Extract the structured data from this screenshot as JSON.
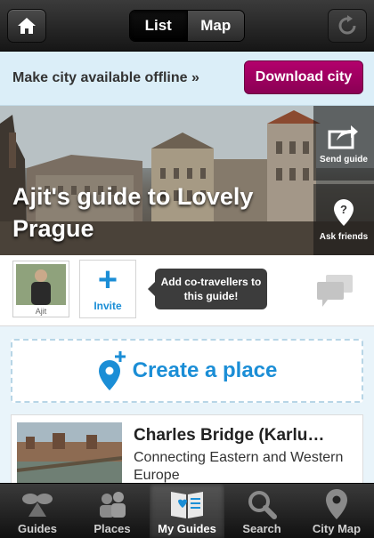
{
  "topbar": {
    "home_icon": "home-icon",
    "segments": [
      {
        "label": "List",
        "active": true
      },
      {
        "label": "Map",
        "active": false
      }
    ],
    "refresh_icon": "refresh-icon"
  },
  "offline": {
    "text": "Make city available offline »",
    "button_label": "Download city",
    "button_color": "#a00062"
  },
  "hero": {
    "title": "Ajit's guide to Lovely Prague",
    "send_label": "Send guide",
    "ask_label": "Ask friends"
  },
  "cotravellers": {
    "avatar_name": "Ajit",
    "invite_label": "Invite",
    "tooltip": "Add co-travellers to this guide!"
  },
  "create_place": {
    "label": "Create a place",
    "accent": "#1b8ed6"
  },
  "places": [
    {
      "title": "Charles Bridge (Karlu…",
      "description": "Connecting Eastern and Western Europe"
    }
  ],
  "tabs": [
    {
      "label": "Guides",
      "icon": "guides-icon",
      "active": false
    },
    {
      "label": "Places",
      "icon": "places-icon",
      "active": false
    },
    {
      "label": "My Guides",
      "icon": "my-guides-icon",
      "active": true
    },
    {
      "label": "Search",
      "icon": "search-icon",
      "active": false
    },
    {
      "label": "City Map",
      "icon": "city-map-icon",
      "active": false
    }
  ]
}
